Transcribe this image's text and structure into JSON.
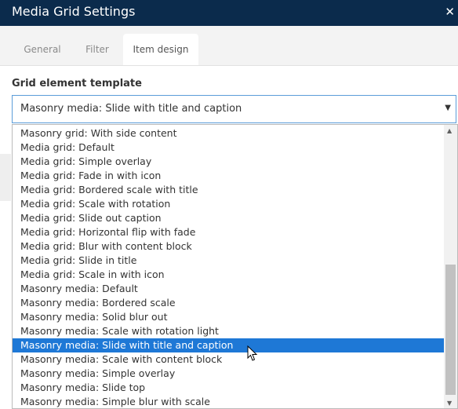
{
  "window": {
    "title": "Media Grid Settings",
    "close_glyph": "✕"
  },
  "tabs": [
    {
      "label": "General"
    },
    {
      "label": "Filter"
    },
    {
      "label": "Item design",
      "active": true
    }
  ],
  "field": {
    "label": "Grid element template",
    "selected_value": "Masonry media: Slide with title and caption",
    "arrow_glyph": "▼"
  },
  "options": [
    "Masonry grid: With side content",
    "Media grid: Default",
    "Media grid: Simple overlay",
    "Media grid: Fade in with icon",
    "Media grid: Bordered scale with title",
    "Media grid: Scale with rotation",
    "Media grid: Slide out caption",
    "Media grid: Horizontal flip with fade",
    "Media grid: Blur with content block",
    "Media grid: Slide in title",
    "Media grid: Scale in with icon",
    "Masonry media: Default",
    "Masonry media: Bordered scale",
    "Masonry media: Solid blur out",
    "Masonry media: Scale with rotation light",
    "Masonry media: Slide with title and caption",
    "Masonry media: Scale with content block",
    "Masonry media: Simple overlay",
    "Masonry media: Slide top",
    "Masonry media: Simple blur with scale"
  ],
  "selected_index": 15,
  "scrollbar": {
    "up_glyph": "▲",
    "down_glyph": "▼"
  },
  "colors": {
    "titlebar": "#0b2b4c",
    "selection": "#1e78d6",
    "focus_border": "#5b9dd9"
  }
}
